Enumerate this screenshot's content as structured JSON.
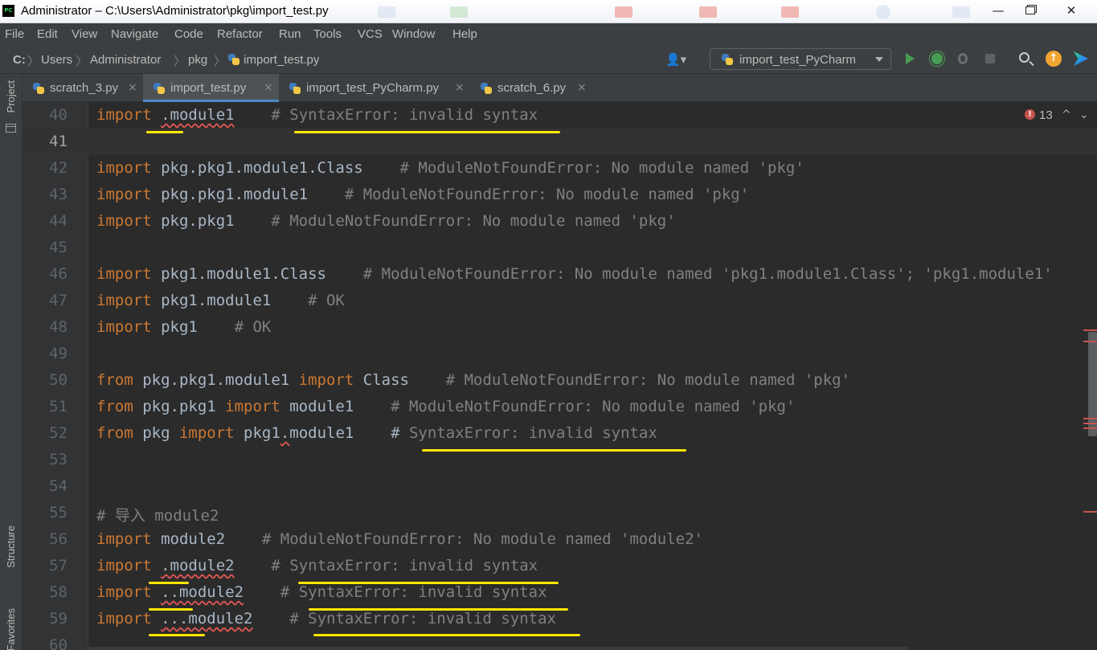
{
  "window": {
    "app_logo": "PC",
    "title": "Administrator – C:\\Users\\Administrator\\pkg\\import_test.py",
    "minimize": "—",
    "close": "✕"
  },
  "menu": [
    "File",
    "Edit",
    "View",
    "Navigate",
    "Code",
    "Refactor",
    "Run",
    "Tools",
    "VCS",
    "Window",
    "Help"
  ],
  "breadcrumb": [
    "C:",
    "Users",
    "Administrator",
    "pkg",
    "import_test.py"
  ],
  "breadcrumb_sep": "〉",
  "toolbar": {
    "user_icon": "👤▾",
    "run_config": "import_test_PyCharm",
    "icons": [
      "run-icon",
      "debug-icon",
      "coverage-icon",
      "stop-icon",
      "search-icon",
      "update-icon",
      "toolbox-icon"
    ],
    "update_glyph": "↑"
  },
  "left_stripe": {
    "project": "Project",
    "structure": "Structure",
    "favorites": "Favorites"
  },
  "tabs": [
    {
      "label": "scratch_3.py",
      "active": false
    },
    {
      "label": "import_test.py",
      "active": true
    },
    {
      "label": "import_test_PyCharm.py",
      "active": false
    },
    {
      "label": "scratch_6.py",
      "active": false
    }
  ],
  "tab_close": "×",
  "inspection": {
    "error_glyph": "!",
    "errors": "13",
    "up": "^",
    "down": "⌄"
  },
  "lines": [
    {
      "n": "40",
      "kw1": "import",
      "a": " ",
      "sq": ".module1",
      "b": "    # ",
      "cmt": "SyntaxError: invalid syntax"
    },
    {
      "n": "41"
    },
    {
      "n": "42",
      "kw1": "import",
      "a": " pkg.pkg1.module1.Class    ",
      "cmt": "# ModuleNotFoundError: No module named 'pkg'"
    },
    {
      "n": "43",
      "kw1": "import",
      "a": " pkg.pkg1.module1    ",
      "cmt": "# ModuleNotFoundError: No module named 'pkg'"
    },
    {
      "n": "44",
      "kw1": "import",
      "a": " pkg.pkg1    ",
      "cmt": "# ModuleNotFoundError: No module named 'pkg'"
    },
    {
      "n": "45"
    },
    {
      "n": "46",
      "kw1": "import",
      "a": " pkg1.module1.Class    ",
      "cmt": "# ModuleNotFoundError: No module named 'pkg1.module1.Class'; 'pkg1.module1'"
    },
    {
      "n": "47",
      "kw1": "import",
      "a": " pkg1.module1    ",
      "cmt": "# OK"
    },
    {
      "n": "48",
      "kw1": "import",
      "a": " pkg1    ",
      "cmt": "# OK"
    },
    {
      "n": "49"
    },
    {
      "n": "50",
      "kw1": "from",
      "a": " pkg.pkg1.module1 ",
      "kw2": "import",
      "c": " Class    ",
      "cmt": "# ModuleNotFoundError: No module named 'pkg'"
    },
    {
      "n": "51",
      "kw1": "from",
      "a": " pkg.pkg1 ",
      "kw2": "import",
      "c": " module1    ",
      "cmt": "# ModuleNotFoundError: No module named 'pkg'"
    },
    {
      "n": "52",
      "kw1": "from",
      "a": " pkg ",
      "kw2": "import",
      "c": " pkg1",
      "sq": ".",
      "d": "module1    # ",
      "cmt": "SyntaxError: invalid syntax"
    },
    {
      "n": "53"
    },
    {
      "n": "54"
    },
    {
      "n": "55",
      "cmt": "# 导入 module2"
    },
    {
      "n": "56",
      "kw1": "import",
      "a": " module2    ",
      "cmt": "# ModuleNotFoundError: No module named 'module2'"
    },
    {
      "n": "57",
      "kw1": "import",
      "a": " ",
      "sq": ".module2",
      "b": "    # ",
      "cmt": "SyntaxError: invalid syntax"
    },
    {
      "n": "58",
      "kw1": "import",
      "a": " ",
      "sq": "..module2",
      "b": "    # ",
      "cmt": "SyntaxError: invalid syntax"
    },
    {
      "n": "59",
      "kw1": "import",
      "a": " ",
      "sq": "...module2",
      "b": "    # ",
      "cmt": "SyntaxError: invalid syntax"
    },
    {
      "n": "60"
    }
  ]
}
